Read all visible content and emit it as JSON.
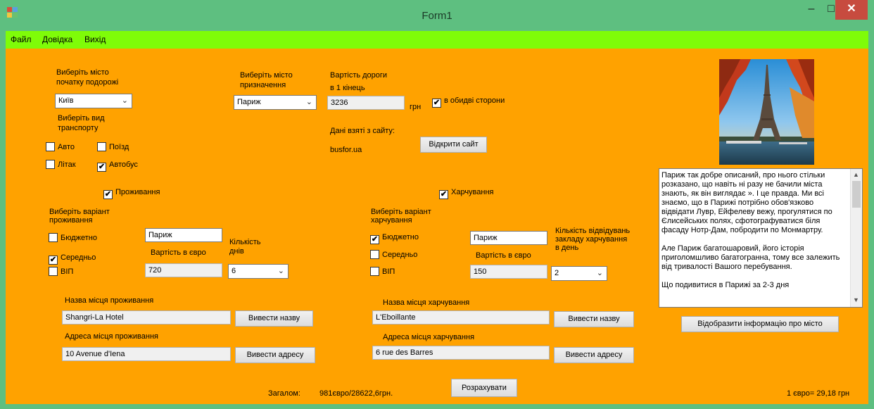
{
  "window": {
    "title": "Form1",
    "min": "‒",
    "max": "□",
    "close": "✕"
  },
  "menu": [
    "Файл",
    "Довідка",
    "Вихід"
  ],
  "origin": {
    "label": "Виберіть місто початку подорожі",
    "value": "Київ",
    "transport_label": "Виберіть вид транспорту",
    "transport": [
      {
        "label": "Авто",
        "checked": ""
      },
      {
        "label": "Поїзд",
        "checked": ""
      },
      {
        "label": "Літак",
        "checked": ""
      },
      {
        "label": "Автобус",
        "checked": "✔"
      }
    ]
  },
  "destination": {
    "label": "Виберіть місто призначення",
    "value": "Париж"
  },
  "road": {
    "label_1": "Вартість дороги",
    "label_2": "в 1 кінець",
    "value": "3236",
    "unit": "грн",
    "both_ways": {
      "label": "в обидві сторони",
      "checked": "✔"
    },
    "source_label": "Дані взяті з сайту:",
    "source": "busfor.ua",
    "open_site_button": "Відкрити сайт"
  },
  "lodging": {
    "enabled": {
      "label": "Проживання",
      "checked": "✔"
    },
    "variant_label": "Виберіть варіант проживання",
    "options": [
      {
        "label": "Бюджетно",
        "checked": ""
      },
      {
        "label": "Середньо",
        "checked": "✔"
      },
      {
        "label": "ВІП",
        "checked": ""
      }
    ],
    "city": "Париж",
    "price_label": "Вартість в євро",
    "price": "720",
    "days_label": "Кількість днів",
    "days": "6",
    "name_label": "Назва місця проживання",
    "name": "Shangri-La Hotel",
    "name_button": "Вивести назву",
    "address_label": "Адреса місця проживання",
    "address": "10 Avenue d'Iena",
    "address_button": "Вивести адресу"
  },
  "food": {
    "enabled": {
      "label": "Харчування",
      "checked": "✔"
    },
    "variant_label": "Виберіть варіант харчування",
    "options": [
      {
        "label": "Бюджетно",
        "checked": "✔"
      },
      {
        "label": "Середньо",
        "checked": ""
      },
      {
        "label": "ВІП",
        "checked": ""
      }
    ],
    "city": "Париж",
    "price_label": "Вартість в євро",
    "price": "150",
    "visits_label": "Кількість відвідувань закладу харчування в день",
    "visits": "2",
    "name_label": "Назва місця харчування",
    "name": "L'Eboillante",
    "name_button": "Вивести назву",
    "address_label": "Адреса місця харчування",
    "address": "6 rue des Barres",
    "address_button": "Вивести адресу"
  },
  "info": {
    "paragraphs": [
      "Париж так добре описаний, про нього стільки розказано, що навіть ні разу не бачили міста знають, як він виглядає ». І це правда. Ми всі знаємо, що в Парижі потрібно обов'язково відвідати Лувр, Ейфелеву вежу, прогулятися по Єлисейських полях, сфотографуватися біля фасаду Нотр-Дам, побродити по Монмартру.",
      "Але Париж багатошаровий, його історія приголомшливо багатогранна, тому все залежить від тривалості Вашого перебування.",
      "Що подивитися в Парижі за 2-3 дня"
    ],
    "button": "Відобразити інформацію про місто"
  },
  "total": {
    "label": "Загалом:",
    "value": "981євро/28622,6грн.",
    "calc_button": "Розрахувати",
    "rate": "1 євро=   29,18  грн"
  },
  "colors": {
    "titlebar": "#5ebf80",
    "menubar": "#7ffc08",
    "client": "#ffa200",
    "close": "#c74b3f"
  }
}
